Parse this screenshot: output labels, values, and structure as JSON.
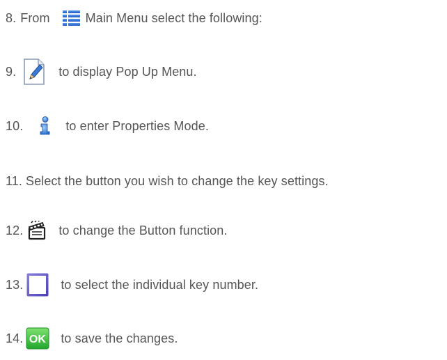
{
  "steps": [
    {
      "number": "8.",
      "label": "From",
      "icon": "main-menu-list-icon",
      "text": "Main Menu select the following:"
    },
    {
      "number": "9.",
      "icon": "edit-pencil-icon",
      "text": "to display Pop Up Menu."
    },
    {
      "number": "10.",
      "icon": "info-properties-icon",
      "text": "to enter Properties Mode."
    },
    {
      "number": "11.",
      "text": "Select the button you wish to change the key settings."
    },
    {
      "number": "12.",
      "icon": "clapperboard-icon",
      "text": "to change the Button function."
    },
    {
      "number": "13.",
      "icon": "key-square-icon",
      "text": "to select the individual key number."
    },
    {
      "number": "14.",
      "icon": "ok-button-icon",
      "icon_text": "OK",
      "text": "to save the changes."
    }
  ],
  "colors": {
    "text": "#555555",
    "menu_icon_blue": "#2f6fd6",
    "ok_green": "#38c23a",
    "square_purple": "#6a60c8"
  }
}
